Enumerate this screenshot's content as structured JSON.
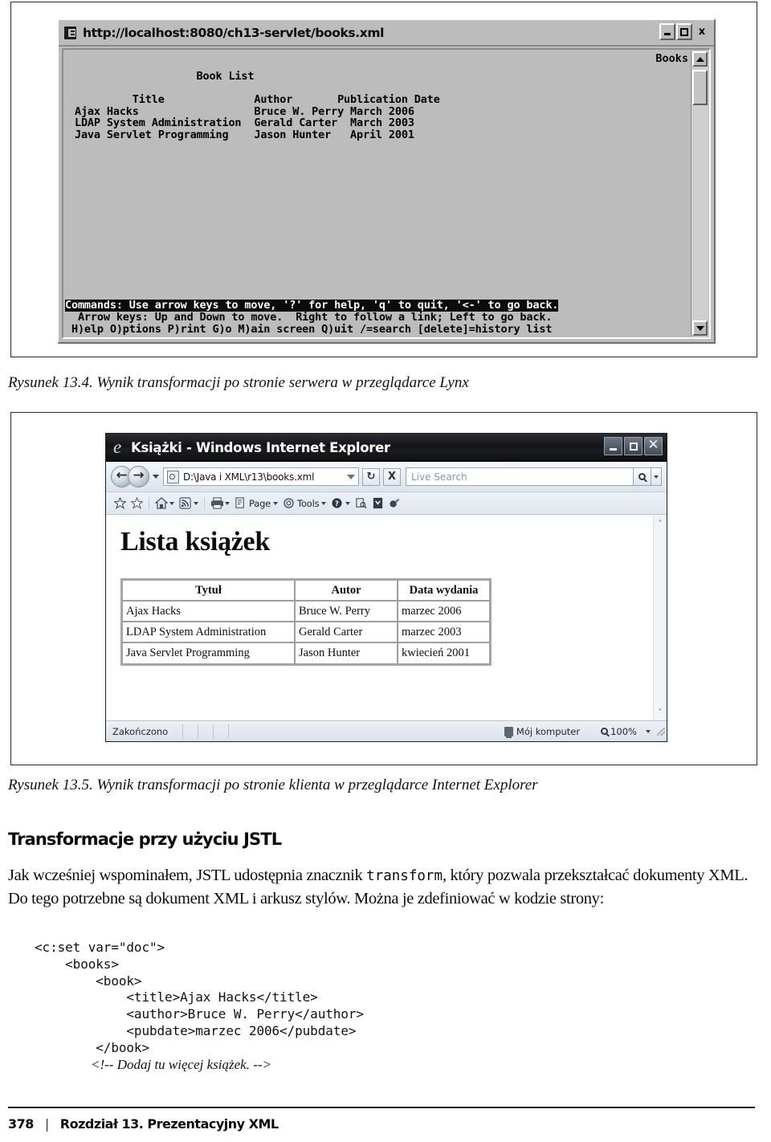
{
  "figure1": {
    "caption": "Rysunek 13.4. Wynik transformacji po stronie serwera w przeglądarce Lynx",
    "window": {
      "url": "http://localhost:8080/ch13-servlet/books.xml",
      "corner_label": "Books",
      "minimize_label": "–",
      "maximize_label": "□",
      "close_label": "x",
      "content": "                    Book List\n\n          Title              Author       Publication Date\n Ajax Hacks                  Bruce W. Perry March 2006\n LDAP System Administration  Gerald Carter  March 2003\n Java Servlet Programming    Jason Hunter   April 2001",
      "status_line1": "Commands: Use arrow keys to move, '?' for help, 'q' to quit, '<-' to go back.",
      "status_line2": "  Arrow keys: Up and Down to move.  Right to follow a link; Left to go back.",
      "status_line3": " H)elp O)ptions P)rint G)o M)ain screen Q)uit /=search [delete]=history list",
      "table": {
        "headers": [
          "Title",
          "Author",
          "Publication Date"
        ],
        "rows": [
          [
            "Ajax Hacks",
            "Bruce W. Perry",
            "March 2006"
          ],
          [
            "LDAP System Administration",
            "Gerald Carter",
            "March 2003"
          ],
          [
            "Java Servlet Programming",
            "Jason Hunter",
            "April 2001"
          ]
        ],
        "heading": "Book List"
      }
    }
  },
  "figure2": {
    "caption": "Rysunek 13.5. Wynik transformacji po stronie klienta w przeglądarce Internet Explorer",
    "window": {
      "title": "Książki - Windows Internet Explorer",
      "address_value": "D:\\Java i XML\\r13\\books.xml",
      "search_placeholder": "Live Search",
      "back_glyph": "←",
      "forward_glyph": "→",
      "refresh_glyph": "↻",
      "stop_glyph": "X",
      "commandbar": [
        {
          "label": "",
          "icon": "favorites-star-icon"
        },
        {
          "label": "",
          "icon": "add-favorites-star-icon"
        },
        {
          "label": "",
          "icon": "home-icon"
        },
        {
          "label": "",
          "icon": "feeds-icon"
        },
        {
          "label": "",
          "icon": "print-icon"
        },
        {
          "label": "Page",
          "icon": "page-icon"
        },
        {
          "label": "Tools",
          "icon": "tools-gear-icon"
        },
        {
          "label": "",
          "icon": "help-icon"
        },
        {
          "label": "",
          "icon": "research-icon"
        },
        {
          "label": "",
          "icon": "messenger-icon"
        },
        {
          "label": "",
          "icon": "blog-icon"
        }
      ],
      "page": {
        "heading": "Lista książek",
        "table": {
          "headers": [
            "Tytuł",
            "Autor",
            "Data wydania"
          ],
          "rows": [
            [
              "Ajax Hacks",
              "Bruce W. Perry",
              "marzec 2006"
            ],
            [
              "LDAP System Administration",
              "Gerald Carter",
              "marzec 2003"
            ],
            [
              "Java Servlet Programming",
              "Jason Hunter",
              "kwiecień 2001"
            ]
          ]
        }
      },
      "statusbar": {
        "status": "Zakończono",
        "zone": "Mój komputer",
        "zoom": "100%"
      }
    }
  },
  "section": {
    "heading": "Transformacje przy użyciu JSTL",
    "paragraph_part1": "Jak wcześniej wspominałem, JSTL udostępnia znacznik ",
    "paragraph_mono": "transform",
    "paragraph_part2": ", który pozwala przekształcać dokumenty XML. Do tego potrzebne są dokument XML i arkusz stylów. Można je zdefiniować w kodzie strony:",
    "code": "<c:set var=\"doc\">\n    <books>\n        <book>\n            <title>Ajax Hacks</title>\n            <author>Bruce W. Perry</author>\n            <pubdate>marzec 2006</pubdate>\n        </book>",
    "code_comment": "<!-- Dodaj tu więcej książek. -->"
  },
  "footer": {
    "page_number": "378",
    "separator": "|",
    "chapter": "Rozdział 13. Prezentacyjny XML"
  }
}
